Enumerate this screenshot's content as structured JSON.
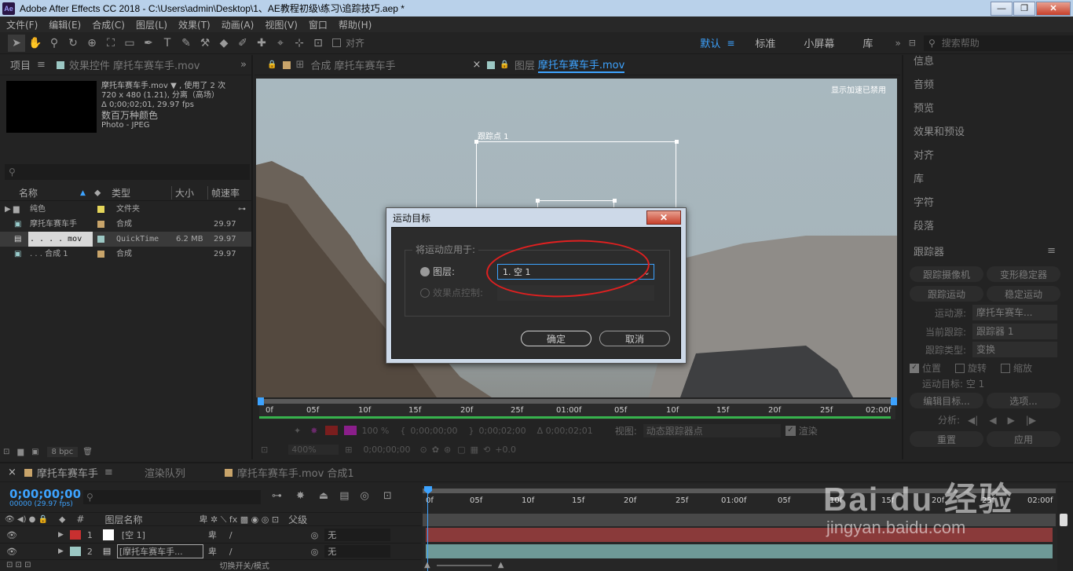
{
  "window": {
    "title": "Adobe After Effects CC 2018 - C:\\Users\\admin\\Desktop\\1、AE教程初级\\练习\\追踪技巧.aep *",
    "logo": "Ae",
    "min": "—",
    "max": "❐",
    "close": "✕"
  },
  "menu": [
    "文件(F)",
    "编辑(E)",
    "合成(C)",
    "图层(L)",
    "效果(T)",
    "动画(A)",
    "视图(V)",
    "窗口",
    "帮助(H)"
  ],
  "toolbar": {
    "align_label": "对齐",
    "workspaces": [
      "默认",
      "标准",
      "小屏幕",
      "库"
    ],
    "active_workspace": "默认",
    "search_placeholder": "搜索帮助"
  },
  "project": {
    "tab_label": "项目",
    "effect_tab": "效果控件 摩托车赛车手.mov",
    "info_line1": "摩托车赛车手.mov ▼ , 使用了 2 次",
    "info_line2": "720 x 480 (1.21), 分离（高场）",
    "info_line3": "Δ 0;00;02;01, 29.97 fps",
    "info_line4": "数百万种颜色",
    "info_line5": "Photo - JPEG",
    "col_name": "名称",
    "col_type": "类型",
    "col_size": "大小",
    "col_rate": "帧速率",
    "items": [
      {
        "name": "纯色",
        "color": "#e5d65a",
        "type": "文件夹",
        "size": "",
        "rate": ""
      },
      {
        "name": "摩托车赛车手",
        "color": "#c8a46a",
        "type": "合成",
        "size": "",
        "rate": "29.97"
      },
      {
        "name": ". . . . mov",
        "color": "#9cc8c4",
        "type": "QuickTime",
        "size": "6.2 MB",
        "rate": "29.97"
      },
      {
        "name": ". . . 合成 1",
        "color": "#c8a46a",
        "type": "合成",
        "size": "",
        "rate": "29.97"
      }
    ],
    "bpc": "8 bpc"
  },
  "viewer": {
    "comp_tab": "合成 摩托车赛车手",
    "layer_tab_prefix": "图层",
    "layer_tab_name": "摩托车赛车手.mov",
    "accel_notice": "显示加速已禁用",
    "track_point_label": "跟踪点 1",
    "ruler": [
      "0f",
      "05f",
      "10f",
      "15f",
      "20f",
      "25f",
      "01:00f",
      "05f",
      "10f",
      "15f",
      "20f",
      "25f",
      "02:00f"
    ],
    "controls": {
      "zoom_pct": "100 %",
      "time_in": "0;00;00;00",
      "time_out": "0;00;02;00",
      "duration": "Δ 0;00;02;01",
      "view_label": "视图:",
      "view_value": "动态跟踪器点",
      "render_label": "渲染",
      "mag": "400%",
      "cur_time": "0;00;00;00",
      "exposure": "+0.0"
    }
  },
  "dialog": {
    "title": "运动目标",
    "group_label": "将运动应用于:",
    "layer_label": "图层:",
    "layer_value": "1. 空 1",
    "effect_label": "效果点控制:",
    "ok": "确定",
    "cancel": "取消"
  },
  "right": {
    "items": [
      "信息",
      "音频",
      "预览",
      "效果和预设",
      "对齐",
      "库",
      "字符",
      "段落"
    ],
    "tracker_title": "跟踪器",
    "track_camera": "跟踪摄像机",
    "warp_stab": "变形稳定器",
    "track_motion": "跟踪运动",
    "stabilize": "稳定运动",
    "motion_source_label": "运动源:",
    "motion_source": "摩托车赛车...",
    "current_track_label": "当前跟踪:",
    "current_track": "跟踪器 1",
    "track_type_label": "跟踪类型:",
    "track_type": "变换",
    "position": "位置",
    "rotation": "旋转",
    "scale": "缩放",
    "motion_target": "运动目标: 空 1",
    "edit_target": "编辑目标...",
    "options": "选项...",
    "analyze": "分析:",
    "reset": "重置",
    "apply": "应用"
  },
  "timeline": {
    "tab1": "摩托车赛车手",
    "tab2": "渲染队列",
    "tab3": "摩托车赛车手.mov 合成1",
    "timecode": "0;00;00;00",
    "frames": "00000 (29.97 fps)",
    "col_hash": "#",
    "col_layername": "图层名称",
    "col_parent": "父级",
    "switch_label": "切换开关/模式",
    "ruler": [
      "0f",
      "05f",
      "10f",
      "15f",
      "20f",
      "25f",
      "01:00f",
      "05f",
      "10f",
      "15f",
      "20f",
      "25f",
      "02:00f"
    ],
    "layers": [
      {
        "num": "1",
        "name": "[空 1]",
        "color": "#c83030",
        "parent": "无"
      },
      {
        "num": "2",
        "name": "[摩托车赛车手...",
        "color": "#9cc8c4",
        "parent": "无"
      }
    ]
  },
  "watermark": {
    "brand": "Bai du 经验",
    "url": "jingyan.baidu.com"
  }
}
